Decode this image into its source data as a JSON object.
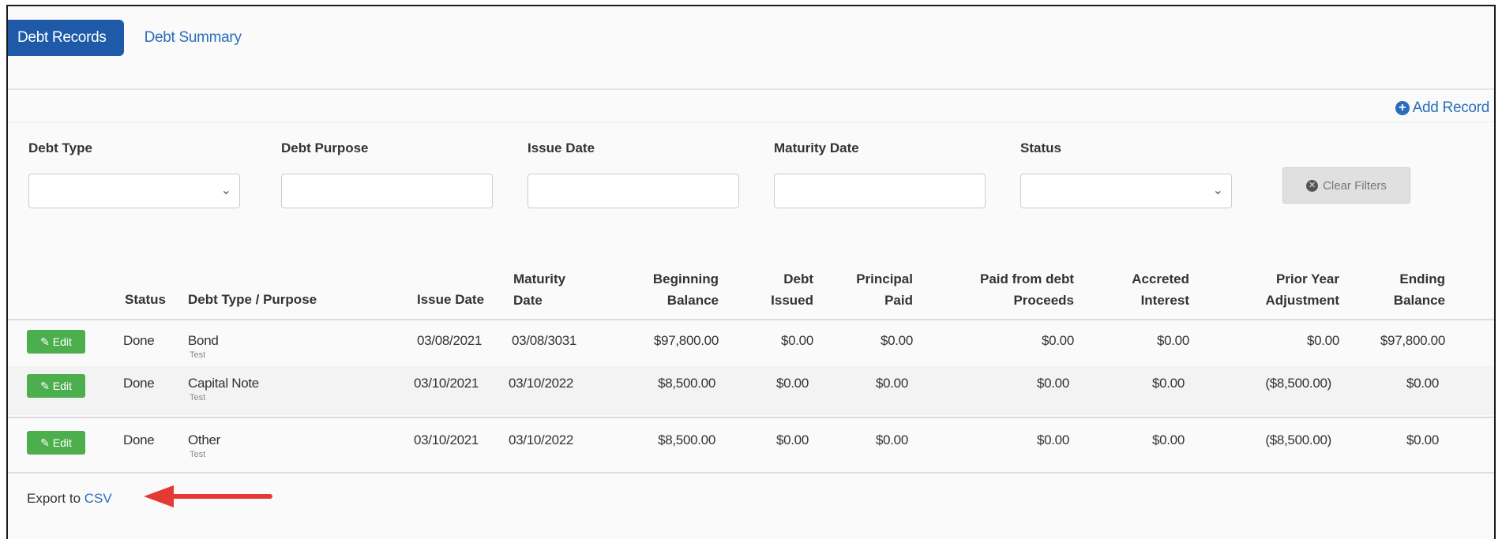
{
  "tabs": [
    {
      "label": "Debt Records",
      "active": true
    },
    {
      "label": "Debt Summary",
      "active": false
    }
  ],
  "add_record": {
    "label": "Add Record",
    "icon": "plus-circle-icon"
  },
  "filters": {
    "debt_type": {
      "label": "Debt Type",
      "value": ""
    },
    "debt_purpose": {
      "label": "Debt Purpose",
      "value": ""
    },
    "issue_date": {
      "label": "Issue Date",
      "value": ""
    },
    "maturity_date": {
      "label": "Maturity Date",
      "value": ""
    },
    "status": {
      "label": "Status",
      "value": ""
    },
    "clear_label": "Clear Filters"
  },
  "table": {
    "headers": {
      "status": "Status",
      "debt_type_purpose": "Debt Type / Purpose",
      "issue_date": "Issue Date",
      "maturity_date_1": "Maturity",
      "maturity_date_2": "Date",
      "beginning_balance_1": "Beginning",
      "beginning_balance_2": "Balance",
      "debt_issued_1": "Debt",
      "debt_issued_2": "Issued",
      "principal_paid_1": "Principal",
      "principal_paid_2": "Paid",
      "paid_from_proceeds_1": "Paid from debt",
      "paid_from_proceeds_2": "Proceeds",
      "accreted_interest_1": "Accreted",
      "accreted_interest_2": "Interest",
      "prior_year_adjustment_1": "Prior Year",
      "prior_year_adjustment_2": "Adjustment",
      "ending_balance_1": "Ending",
      "ending_balance_2": "Balance"
    },
    "edit_label": "Edit",
    "rows": [
      {
        "status": "Done",
        "type": "Bond",
        "purpose": "Test",
        "issue_date": "03/08/2021",
        "maturity_date": "03/08/3031",
        "beginning_balance": "$97,800.00",
        "debt_issued": "$0.00",
        "principal_paid": "$0.00",
        "paid_from_proceeds": "$0.00",
        "accreted_interest": "$0.00",
        "prior_year_adjustment": "$0.00",
        "ending_balance": "$97,800.00"
      },
      {
        "status": "Done",
        "type": "Capital Note",
        "purpose": "Test",
        "issue_date": "03/10/2021",
        "maturity_date": "03/10/2022",
        "beginning_balance": "$8,500.00",
        "debt_issued": "$0.00",
        "principal_paid": "$0.00",
        "paid_from_proceeds": "$0.00",
        "accreted_interest": "$0.00",
        "prior_year_adjustment": "($8,500.00)",
        "ending_balance": "$0.00"
      },
      {
        "status": "Done",
        "type": "Other",
        "purpose": "Test",
        "issue_date": "03/10/2021",
        "maturity_date": "03/10/2022",
        "beginning_balance": "$8,500.00",
        "debt_issued": "$0.00",
        "principal_paid": "$0.00",
        "paid_from_proceeds": "$0.00",
        "accreted_interest": "$0.00",
        "prior_year_adjustment": "($8,500.00)",
        "ending_balance": "$0.00"
      }
    ]
  },
  "export": {
    "prefix": "Export to",
    "link": "CSV"
  },
  "colors": {
    "primary": "#1e5aa8",
    "link": "#2a6ebb",
    "edit_green": "#4cae4c",
    "annotation_arrow": "#e53935"
  }
}
